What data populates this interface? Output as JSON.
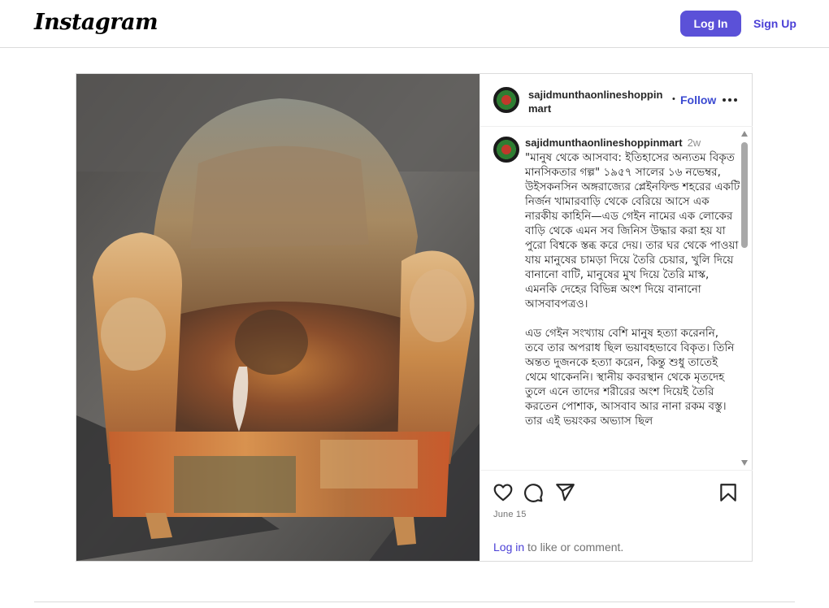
{
  "header": {
    "logo": "Instagram",
    "login_label": "Log In",
    "signup_label": "Sign Up"
  },
  "post": {
    "username_line1": "sajidmunthaonlineshoppin",
    "username_line2": "mart",
    "dot": "•",
    "follow_label": "Follow",
    "caption": {
      "username": "sajidmunthaonlineshoppinmart",
      "time": "2w",
      "paragraph1": "\"মানুষ থেকে আসবাব: ইতিহাসের অন্যতম বিকৃত মানসিকতার গল্প\" ১৯৫৭ সালের ১৬ নভেম্বর, উইসকনসিন অঙ্গরাজ্যের প্লেইনফিল্ড শহরের একটি নির্জন খামারবাড়ি থেকে বেরিয়ে আসে এক নারকীয় কাহিনি—এড গেইন নামের এক লোকের বাড়ি থেকে এমন সব জিনিস উদ্ধার করা হয় যা পুরো বিশ্বকে স্তব্ধ করে দেয়। তার ঘর থেকে পাওয়া যায় মানুষের চামড়া দিয়ে তৈরি চেয়ার, খুলি দিয়ে বানানো বাটি, মানুষের মুখ দিয়ে তৈরি মাস্ক, এমনকি দেহের বিভিন্ন অংশ দিয়ে বানানো আসবাবপত্রও।",
      "paragraph2": "এড গেইন সংখ্যায় বেশি মানুষ হত্যা করেননি, তবে তার অপরাধ ছিল ভয়াবহভাবে বিকৃত। তিনি অন্তত দুজনকে হত্যা করেন, কিন্তু শুধু তাতেই থেমে থাকেননি। স্থানীয় কবরস্থান থেকে মৃতদেহ তুলে এনে তাদের শরীরের অংশ দিয়েই তৈরি করতেন পোশাক, আসবাব আর নানা রকম বস্তু। তার এই ভয়ংকর অভ্যাস ছিল"
    },
    "date": "June 15",
    "login_prompt_link": "Log in",
    "login_prompt_rest": " to like or comment."
  }
}
